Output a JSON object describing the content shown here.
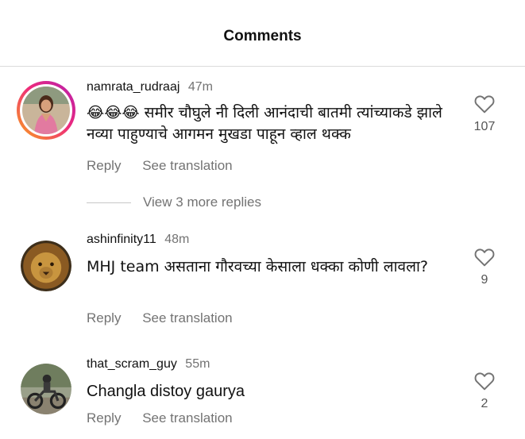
{
  "header": {
    "title": "Comments"
  },
  "comments": [
    {
      "username": "namrata_rudraaj",
      "time": "47m",
      "emoji": "😂😂😂",
      "text": "समीर चौघुले नी दिली आनंदाची बातमी त्यांच्याकडे झाले नव्या पाहुण्याचे आगमन मुखडा पाहून व्हाल थक्क",
      "reply_label": "Reply",
      "see_translation_label": "See translation",
      "likes": "107",
      "view_replies_label": "View 3 more replies"
    },
    {
      "username": "ashinfinity11",
      "time": "48m",
      "text": "MHJ team असताना गौरवच्या केसाला धक्का कोणी लावला?",
      "reply_label": "Reply",
      "see_translation_label": "See translation",
      "likes": "9"
    },
    {
      "username": "that_scram_guy",
      "time": "55m",
      "text": "Changla distoy gaurya",
      "reply_label": "Reply",
      "see_translation_label": "See translation",
      "likes": "2"
    }
  ]
}
